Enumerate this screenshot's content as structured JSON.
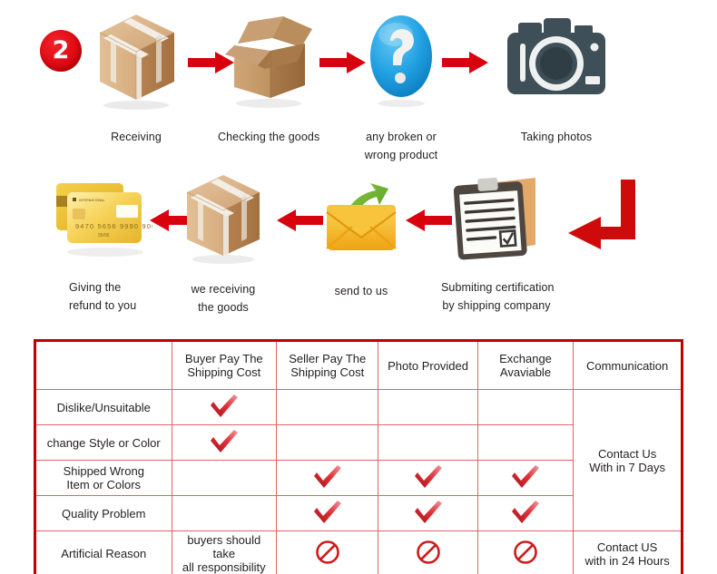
{
  "step_badge": {
    "number": "2"
  },
  "flow": {
    "row1": [
      {
        "icon": "sealed-box-icon",
        "label_lines": [
          "Receiving"
        ]
      },
      {
        "icon": "open-box-icon",
        "label_lines": [
          "Checking the goods"
        ]
      },
      {
        "icon": "question-mark-icon",
        "label_lines": [
          "any broken or",
          "wrong product"
        ]
      },
      {
        "icon": "camera-icon",
        "label_lines": [
          "Taking photos"
        ]
      }
    ],
    "row2": [
      {
        "icon": "credit-cards-icon",
        "label_lines": [
          "Giving the",
          "refund to you"
        ]
      },
      {
        "icon": "sealed-box-icon",
        "label_lines": [
          "we receiving",
          "the goods"
        ]
      },
      {
        "icon": "envelope-send-icon",
        "label_lines": [
          "send to us"
        ]
      },
      {
        "icon": "clipboard-certificate-icon",
        "label_lines": [
          "Submiting certification",
          "by shipping company"
        ]
      }
    ],
    "arrows": {
      "right": "arrow-right-icon",
      "left": "arrow-left-icon",
      "elbow": "elbow-arrow-down-left-icon"
    }
  },
  "table": {
    "headers": [
      "",
      "Buyer Pay The Shipping Cost",
      "Seller Pay The Shipping Cost",
      "Photo Provided",
      "Exchange Avaviable",
      "Communication"
    ],
    "header_lines": {
      "buyer": [
        "Buyer Pay The",
        "Shipping Cost"
      ],
      "seller": [
        "Seller Pay The",
        "Shipping Cost"
      ],
      "photo": [
        "Photo Provided"
      ],
      "exchange": [
        "Exchange",
        "Avaviable"
      ],
      "communication": [
        "Communication"
      ]
    },
    "rows": [
      {
        "reason": "Dislike/Unsuitable",
        "buyer": "check",
        "seller": "",
        "photo": "",
        "exchange": ""
      },
      {
        "reason": "change Style or Color",
        "buyer": "check",
        "seller": "",
        "photo": "",
        "exchange": ""
      },
      {
        "reason": "Shipped Wrong Item or Colors",
        "reason_lines": [
          "Shipped Wrong",
          "Item or Colors"
        ],
        "buyer": "",
        "seller": "check",
        "photo": "check",
        "exchange": "check"
      },
      {
        "reason": "Quality Problem",
        "buyer": "",
        "seller": "check",
        "photo": "check",
        "exchange": "check"
      },
      {
        "reason": "Artificial Reason",
        "buyer_note_lines": [
          "buyers should take",
          "all responsibility"
        ],
        "buyer": "note",
        "seller": "ban",
        "photo": "ban",
        "exchange": "ban"
      }
    ],
    "communication": {
      "merged_lines": [
        "Contact Us",
        "With in 7 Days"
      ],
      "last_lines": [
        "Contact US",
        "with in 24 Hours"
      ]
    },
    "icons": {
      "check": "red-check-icon",
      "ban": "red-prohibition-icon"
    },
    "colors": {
      "border": "#c00000",
      "grid": "#e06464",
      "check": "#d2232a",
      "note_text": "#ee2222",
      "text": "#231f20"
    }
  }
}
